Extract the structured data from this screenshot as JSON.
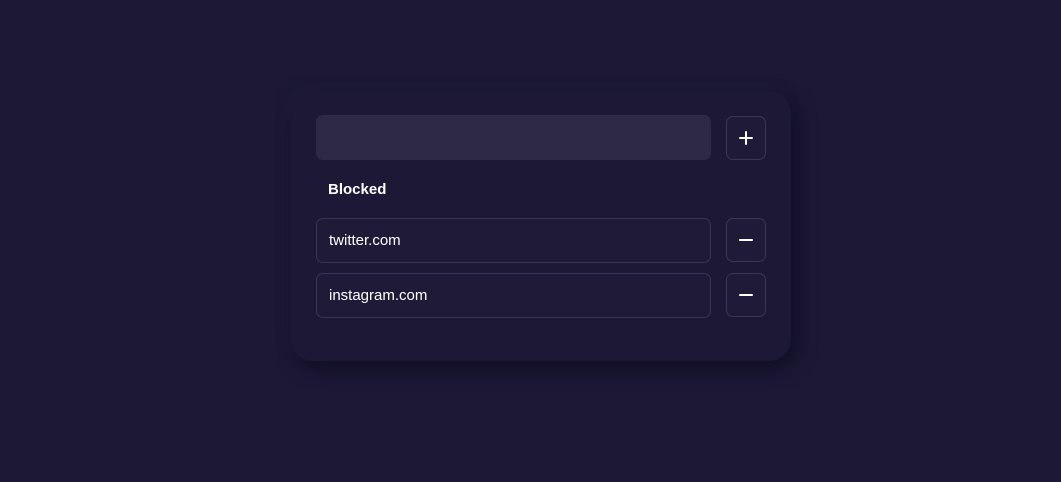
{
  "add_form": {
    "input_value": "",
    "input_placeholder": "",
    "add_icon": "plus-icon"
  },
  "blocked": {
    "heading": "Blocked",
    "items": [
      {
        "domain": "twitter.com",
        "remove_icon": "minus-icon"
      },
      {
        "domain": "instagram.com",
        "remove_icon": "minus-icon"
      }
    ]
  },
  "colors": {
    "background": "#1c1836",
    "input_fill": "#2d2947",
    "border": "#38345a",
    "text": "#ffffff"
  }
}
